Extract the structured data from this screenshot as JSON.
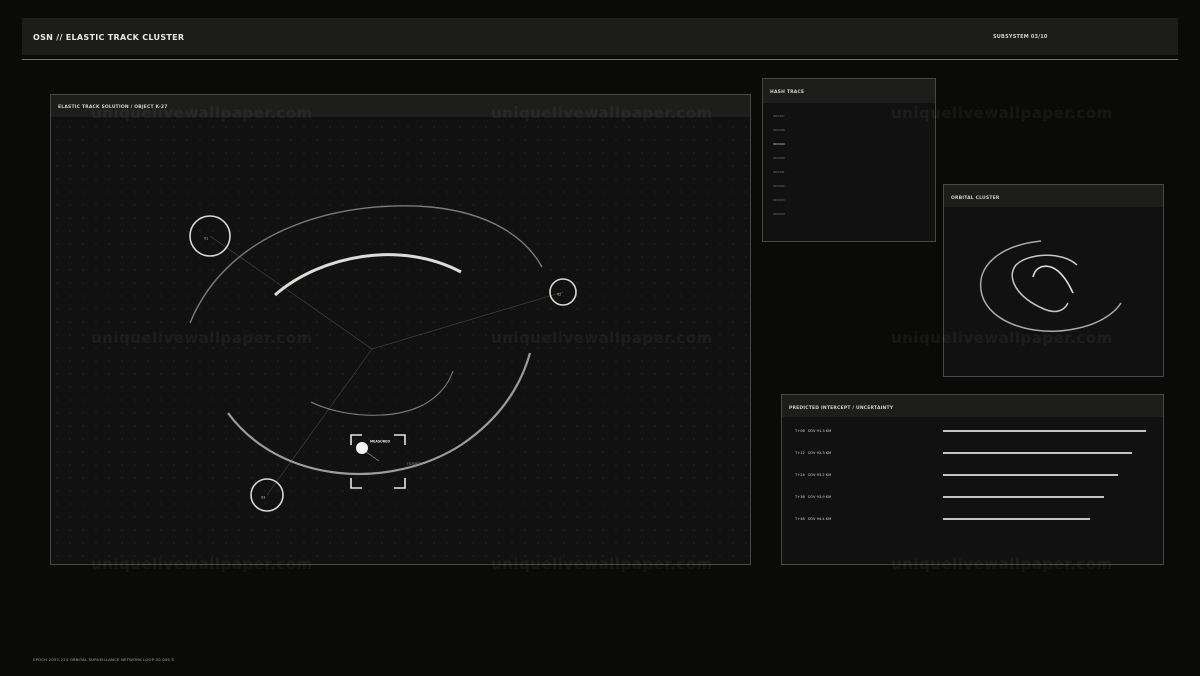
{
  "header": {
    "title": "OSN // ELASTIC TRACK CLUSTER",
    "subsystem": "SUBSYSTEM 03/10"
  },
  "main_panel": {
    "title": "ELASTIC TRACK SOLUTION / OBJECT K-27",
    "nodes": [
      {
        "label": "01"
      },
      {
        "label": "02"
      },
      {
        "label": "03"
      }
    ],
    "measured_label": "MEASURED",
    "filtered_label": "FILTERED"
  },
  "hash_panel": {
    "title": "HASH TRACE",
    "rows": [
      "000C027",
      "000C028",
      "000C029",
      "000C030",
      "000C031",
      "000C032",
      "000C033",
      "000C034"
    ],
    "selected_index": 2
  },
  "orbital_panel": {
    "title": "ORBITAL CLUSTER"
  },
  "prediction_panel": {
    "title": "PREDICTED INTERCEPT / UNCERTAINTY",
    "rows": [
      {
        "time": "T+06",
        "cov": "COV 91.3 KM",
        "fraction": 1.0
      },
      {
        "time": "T+12",
        "cov": "COV 92.3 KM",
        "fraction": 0.931
      },
      {
        "time": "T+24",
        "cov": "COV 93.2 KM",
        "fraction": 0.863
      },
      {
        "time": "T+36",
        "cov": "COV 93.9 KM",
        "fraction": 0.794
      },
      {
        "time": "T+48",
        "cov": "COV 94.4 KM",
        "fraction": 0.725
      }
    ]
  },
  "footer": {
    "text": "EPOCH 2053.224   ORBITAL SURVEILLANCE NETWORK   LOOP 30.000 S"
  },
  "watermark": "uniquelivewallpaper.com"
}
